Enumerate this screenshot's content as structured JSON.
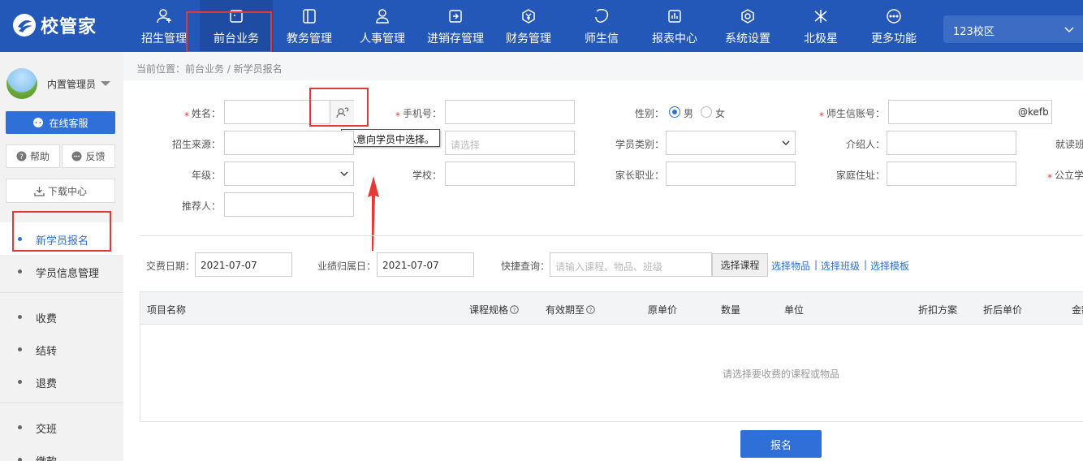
{
  "brand": {
    "name": "校管家"
  },
  "nav": {
    "items": [
      {
        "label": "招生管理",
        "icon": "user-plus-icon"
      },
      {
        "label": "前台业务",
        "icon": "desk-icon"
      },
      {
        "label": "教务管理",
        "icon": "book-icon"
      },
      {
        "label": "人事管理",
        "icon": "person-icon"
      },
      {
        "label": "进销存管理",
        "icon": "inventory-icon"
      },
      {
        "label": "财务管理",
        "icon": "yen-icon"
      },
      {
        "label": "师生信",
        "icon": "message-icon"
      },
      {
        "label": "报表中心",
        "icon": "report-icon"
      },
      {
        "label": "系统设置",
        "icon": "settings-icon"
      },
      {
        "label": "北极星",
        "icon": "star-icon"
      },
      {
        "label": "更多功能",
        "icon": "more-icon"
      }
    ],
    "active": "前台业务",
    "campus": "123校区"
  },
  "sidebar": {
    "user_name": "内置管理员",
    "service_label": "在线客服",
    "help_label": "帮助",
    "feedback_label": "反馈",
    "download_label": "下载中心",
    "menu": [
      {
        "label": "新学员报名",
        "active": true
      },
      {
        "label": "学员信息管理"
      },
      {
        "label": "收费"
      },
      {
        "label": "结转"
      },
      {
        "label": "退费"
      },
      {
        "label": "交班"
      },
      {
        "label": "缴款"
      }
    ]
  },
  "breadcrumb": "当前位置：前台业务 / 新学员报名",
  "form": {
    "name_label": "姓名：",
    "phone_label": "手机号：",
    "gender_label": "性别：",
    "gender_male": "男",
    "gender_female": "女",
    "account_label": "师生信账号：",
    "account_suffix": "@kefb",
    "source_label": "招生来源：",
    "field2_placeholder": "请选择",
    "type_label": "学员类别：",
    "referrer_label": "介绍人：",
    "cutoff_label": "就读班",
    "grade_label": "年级：",
    "school_label": "学校：",
    "parent_job_label": "家长职业：",
    "address_label": "家庭住址：",
    "public_label": "公立学",
    "recommender_label": "推荐人：",
    "tooltip": "从意向学员中选择。"
  },
  "payment": {
    "date_label": "交费日期：",
    "date_value": "2021-07-07",
    "perf_label": "业绩归属日：",
    "perf_value": "2021-07-07",
    "quick_label": "快捷查询：",
    "quick_placeholder": "请输入课程、物品、班级",
    "choose_course": "选择课程",
    "choose_goods": "选择物品",
    "choose_class": "选择班级",
    "choose_template": "选择模板",
    "separator": "|"
  },
  "table": {
    "headers": [
      "项目名称",
      "课程规格",
      "有效期至",
      "原单价",
      "数量",
      "单位",
      "折扣方案",
      "折后单价",
      "金额"
    ],
    "empty": "请选择要收费的课程或物品"
  },
  "submit_label": "报名",
  "colors": {
    "primary": "#2458b8",
    "accent": "#2e70d8",
    "highlight": "#e53935"
  }
}
